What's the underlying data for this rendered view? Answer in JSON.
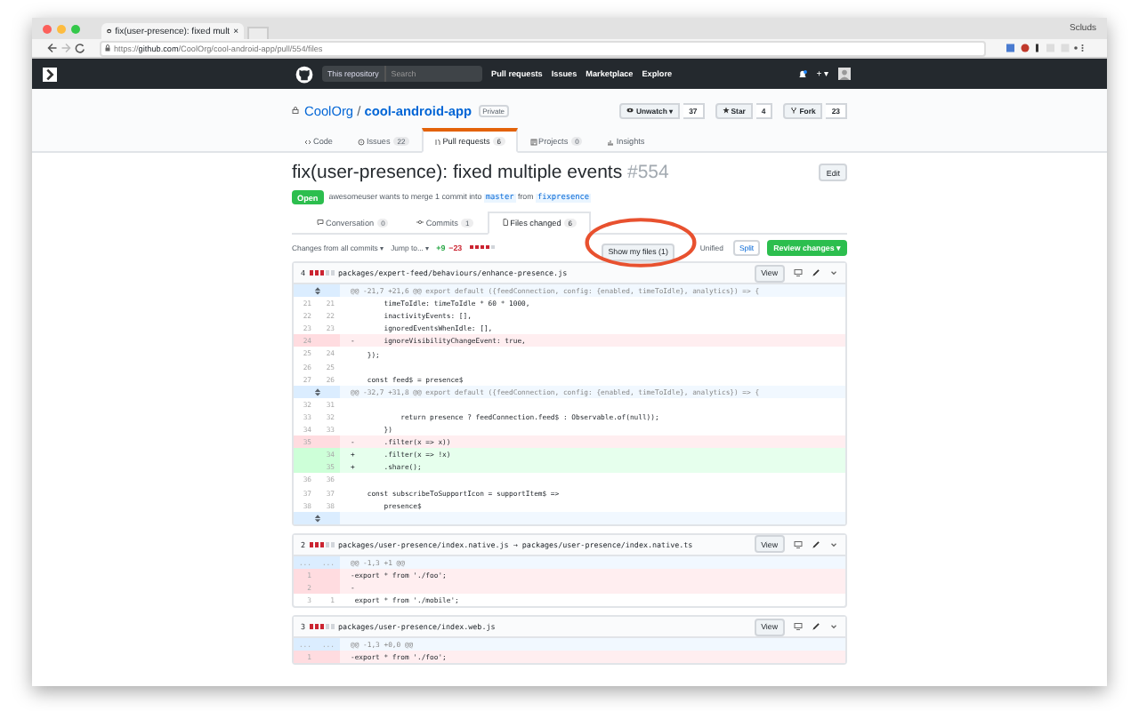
{
  "browser": {
    "tab_title": "fix(user-presence): fixed mult",
    "tab_close": "×",
    "profile_name": "Scluds",
    "url_scheme": "https://",
    "url_host": "github.com",
    "url_path": "/CoolOrg/cool-android-app/pull/554/files"
  },
  "github_header": {
    "scope_label": "This repository",
    "search_placeholder": "Search",
    "nav": [
      "Pull requests",
      "Issues",
      "Marketplace",
      "Explore"
    ],
    "new_menu": "+ ▾"
  },
  "repo": {
    "owner": "CoolOrg",
    "separator": "/",
    "name": "cool-android-app",
    "visibility": "Private",
    "actions": [
      {
        "kind": "watch",
        "label": "Unwatch ▾",
        "count": "37"
      },
      {
        "kind": "star",
        "label": "Star",
        "count": "4"
      },
      {
        "kind": "fork",
        "label": "Fork",
        "count": "23"
      }
    ],
    "tabs": [
      {
        "kind": "code",
        "label": "Code",
        "selected": false
      },
      {
        "kind": "issue",
        "label": "Issues",
        "count": "22",
        "selected": false
      },
      {
        "kind": "pr",
        "label": "Pull requests",
        "count": "6",
        "selected": true
      },
      {
        "kind": "project",
        "label": "Projects",
        "count": "0",
        "selected": false
      },
      {
        "kind": "graph",
        "label": "Insights",
        "selected": false
      }
    ]
  },
  "pr": {
    "title": "fix(user-presence): fixed multiple events",
    "number": "#554",
    "edit": "Edit",
    "state": "Open",
    "merge_text": "awesomeuser wants to merge 1 commit into",
    "base": "master",
    "from_word": "from",
    "head": "fixpresence",
    "tabs": [
      {
        "kind": "conversation",
        "label": "Conversation",
        "count": "0",
        "selected": false
      },
      {
        "kind": "commit",
        "label": "Commits",
        "count": "1",
        "selected": false
      },
      {
        "kind": "files",
        "label": "Files changed",
        "count": "6",
        "selected": true
      }
    ]
  },
  "toolbar": {
    "commits_filter": "Changes from all commits ▾",
    "jump_to": "Jump to... ▾",
    "additions": "+9",
    "deletions": "−23",
    "show_my_files": "Show my files (1)",
    "view_modes": [
      {
        "label": "Unified",
        "selected": false
      },
      {
        "label": "Split",
        "selected": true
      }
    ],
    "review": "Review changes ▾"
  },
  "files": [
    {
      "changes": "4",
      "path": "packages/expert-feed/behaviours/enhance-presence.js",
      "view": "View",
      "lines": [
        {
          "kind": "hunk",
          "text": "@@ -21,7 +21,6 @@ export default ({feedConnection, config: {enabled, timeToIdle}, analytics}) => {"
        },
        {
          "kind": "context",
          "old": "21",
          "new": "21",
          "text": "        timeToIdle: timeToIdle * 60 * 1000,"
        },
        {
          "kind": "context",
          "old": "22",
          "new": "22",
          "text": "        inactivityEvents: [],"
        },
        {
          "kind": "context",
          "old": "23",
          "new": "23",
          "text": "        ignoredEventsWhenIdle: [],"
        },
        {
          "kind": "del",
          "old": "24",
          "text": "-       ignoreVisibilityChangeEvent: true,"
        },
        {
          "kind": "context",
          "old": "25",
          "new": "24",
          "text": "    });"
        },
        {
          "kind": "context",
          "old": "26",
          "new": "25"
        },
        {
          "kind": "context",
          "old": "27",
          "new": "26",
          "text": "    const feed$ = presence$"
        },
        {
          "kind": "hunk",
          "text": "@@ -32,7 +31,8 @@ export default ({feedConnection, config: {enabled, timeToIdle}, analytics}) => {"
        },
        {
          "kind": "context",
          "old": "32",
          "new": "31"
        },
        {
          "kind": "context",
          "old": "33",
          "new": "32",
          "text": "            return presence ? feedConnection.feed$ : Observable.of(null));"
        },
        {
          "kind": "context",
          "old": "34",
          "new": "33",
          "text": "        })"
        },
        {
          "kind": "del",
          "old": "35",
          "text": "-       .filter(x => x))"
        },
        {
          "kind": "add",
          "new": "34",
          "text": "+       .filter(x => !x)"
        },
        {
          "kind": "add",
          "new": "35",
          "text": "+       .share();"
        },
        {
          "kind": "context",
          "old": "36",
          "new": "36"
        },
        {
          "kind": "context",
          "old": "37",
          "new": "37",
          "text": "    const subscribeToSupportIcon = supportItem$ =>"
        },
        {
          "kind": "context",
          "old": "38",
          "new": "38",
          "text": "        presence$"
        },
        {
          "kind": "expand"
        }
      ]
    },
    {
      "changes": "2",
      "path": "packages/user-presence/index.native.js → packages/user-presence/index.native.ts",
      "view": "View",
      "lines": [
        {
          "kind": "hunk",
          "old": "...",
          "new": "...",
          "text": "@@ -1,3 +1 @@"
        },
        {
          "kind": "del",
          "old": "1",
          "text": "-export * from './foo';"
        },
        {
          "kind": "del",
          "old": "2",
          "text": "-"
        },
        {
          "kind": "context",
          "old": "3",
          "new": "1",
          "text": " export * from './mobile';"
        }
      ]
    },
    {
      "changes": "3",
      "path": "packages/user-presence/index.web.js",
      "view": "View",
      "lines": [
        {
          "kind": "hunk",
          "old": "...",
          "new": "...",
          "text": "@@ -1,3 +0,0 @@"
        },
        {
          "kind": "del",
          "old": "1",
          "text": "-export * from './foo';"
        }
      ]
    }
  ]
}
